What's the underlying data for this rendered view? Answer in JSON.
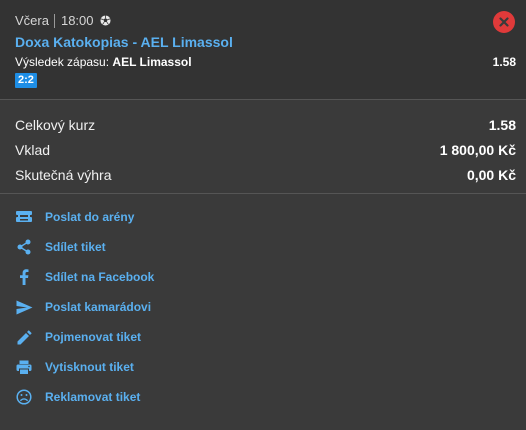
{
  "ticket": {
    "day": "Včera",
    "time": "18:00",
    "sport_icon": "football-icon",
    "close_icon": "close-icon",
    "match": "Doxa Katokopias - AEL Limassol",
    "bet_label": "Výsledek zápasu:",
    "bet_pick": "AEL Limassol",
    "bet_odds": "1.58",
    "score": "2:2"
  },
  "summary": {
    "total_odds_label": "Celkový kurz",
    "total_odds_value": "1.58",
    "stake_label": "Vklad",
    "stake_value": "1 800,00 Kč",
    "win_label": "Skutečná výhra",
    "win_value": "0,00 Kč"
  },
  "actions": [
    {
      "label": "Poslat do arény",
      "icon": "arena-icon"
    },
    {
      "label": "Sdílet tiket",
      "icon": "share-icon"
    },
    {
      "label": "Sdílet na Facebook",
      "icon": "facebook-icon"
    },
    {
      "label": "Poslat kamarádovi",
      "icon": "send-icon"
    },
    {
      "label": "Pojmenovat tiket",
      "icon": "pencil-icon"
    },
    {
      "label": "Vytisknout tiket",
      "icon": "printer-icon"
    },
    {
      "label": "Reklamovat tiket",
      "icon": "sad-face-icon"
    }
  ],
  "colors": {
    "accent": "#5ab0f0",
    "badge": "#1e8ee6",
    "close": "#e03a3a",
    "background": "#3a3a3a",
    "header": "#333333"
  }
}
